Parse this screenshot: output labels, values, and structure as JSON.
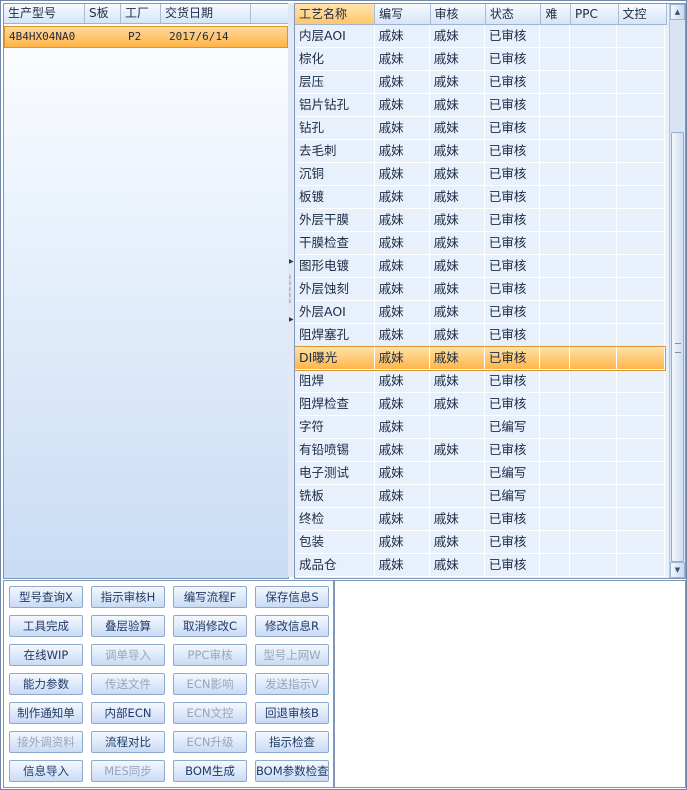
{
  "left_grid": {
    "columns": [
      "生产型号",
      "S板",
      "工厂",
      "交货日期"
    ],
    "rows": [
      {
        "model": "4B4HX04NA0",
        "s_board": "",
        "factory": "P2",
        "delivery_date": "2017/6/14"
      }
    ]
  },
  "right_grid": {
    "columns": [
      "工艺名称",
      "编写",
      "审核",
      "状态",
      "难",
      "PPC",
      "文控"
    ],
    "rows": [
      {
        "process": "内层AOI",
        "writer": "戚妹",
        "reviewer": "戚妹",
        "status": "已审核"
      },
      {
        "process": "棕化",
        "writer": "戚妹",
        "reviewer": "戚妹",
        "status": "已审核"
      },
      {
        "process": "层压",
        "writer": "戚妹",
        "reviewer": "戚妹",
        "status": "已审核"
      },
      {
        "process": "铝片钻孔",
        "writer": "戚妹",
        "reviewer": "戚妹",
        "status": "已审核"
      },
      {
        "process": "钻孔",
        "writer": "戚妹",
        "reviewer": "戚妹",
        "status": "已审核"
      },
      {
        "process": "去毛刺",
        "writer": "戚妹",
        "reviewer": "戚妹",
        "status": "已审核"
      },
      {
        "process": "沉铜",
        "writer": "戚妹",
        "reviewer": "戚妹",
        "status": "已审核"
      },
      {
        "process": "板镀",
        "writer": "戚妹",
        "reviewer": "戚妹",
        "status": "已审核"
      },
      {
        "process": "外层干膜",
        "writer": "戚妹",
        "reviewer": "戚妹",
        "status": "已审核"
      },
      {
        "process": "干膜检查",
        "writer": "戚妹",
        "reviewer": "戚妹",
        "status": "已审核"
      },
      {
        "process": "图形电镀",
        "writer": "戚妹",
        "reviewer": "戚妹",
        "status": "已审核"
      },
      {
        "process": "外层蚀刻",
        "writer": "戚妹",
        "reviewer": "戚妹",
        "status": "已审核"
      },
      {
        "process": "外层AOI",
        "writer": "戚妹",
        "reviewer": "戚妹",
        "status": "已审核"
      },
      {
        "process": "阻焊塞孔",
        "writer": "戚妹",
        "reviewer": "戚妹",
        "status": "已审核"
      },
      {
        "process": "DI曝光",
        "writer": "戚妹",
        "reviewer": "戚妹",
        "status": "已审核",
        "selected": true
      },
      {
        "process": "阻焊",
        "writer": "戚妹",
        "reviewer": "戚妹",
        "status": "已审核"
      },
      {
        "process": "阻焊检查",
        "writer": "戚妹",
        "reviewer": "戚妹",
        "status": "已审核"
      },
      {
        "process": "字符",
        "writer": "戚妹",
        "reviewer": "",
        "status": "已编写"
      },
      {
        "process": "有铅喷锡",
        "writer": "戚妹",
        "reviewer": "戚妹",
        "status": "已审核"
      },
      {
        "process": "电子测试",
        "writer": "戚妹",
        "reviewer": "",
        "status": "已编写"
      },
      {
        "process": "铣板",
        "writer": "戚妹",
        "reviewer": "",
        "status": "已编写"
      },
      {
        "process": "终检",
        "writer": "戚妹",
        "reviewer": "戚妹",
        "status": "已审核"
      },
      {
        "process": "包装",
        "writer": "戚妹",
        "reviewer": "戚妹",
        "status": "已审核"
      },
      {
        "process": "成品仓",
        "writer": "戚妹",
        "reviewer": "戚妹",
        "status": "已审核"
      }
    ]
  },
  "buttons": [
    {
      "label": "型号查询X",
      "enabled": true
    },
    {
      "label": "指示审核H",
      "enabled": true
    },
    {
      "label": "编写流程F",
      "enabled": true
    },
    {
      "label": "保存信息S",
      "enabled": true
    },
    {
      "label": "工具完成",
      "enabled": true
    },
    {
      "label": "叠层验算",
      "enabled": true
    },
    {
      "label": "取消修改C",
      "enabled": true
    },
    {
      "label": "修改信息R",
      "enabled": true
    },
    {
      "label": "在线WIP",
      "enabled": true
    },
    {
      "label": "调单导入",
      "enabled": false
    },
    {
      "label": "PPC审核",
      "enabled": false
    },
    {
      "label": "型号上网W",
      "enabled": false
    },
    {
      "label": "能力参数",
      "enabled": true
    },
    {
      "label": "传送文件",
      "enabled": false
    },
    {
      "label": "ECN影响",
      "enabled": false
    },
    {
      "label": "发送指示V",
      "enabled": false
    },
    {
      "label": "制作通知单",
      "enabled": true
    },
    {
      "label": "内部ECN",
      "enabled": true
    },
    {
      "label": "ECN文控",
      "enabled": false
    },
    {
      "label": "回退审核B",
      "enabled": true
    },
    {
      "label": "接外调资料",
      "enabled": false
    },
    {
      "label": "流程对比",
      "enabled": true
    },
    {
      "label": "ECN升级",
      "enabled": false
    },
    {
      "label": "指示检查",
      "enabled": true
    },
    {
      "label": "信息导入",
      "enabled": true
    },
    {
      "label": "MES同步",
      "enabled": false
    },
    {
      "label": "BOM生成",
      "enabled": true
    },
    {
      "label": "BOM参数检查",
      "enabled": true
    }
  ]
}
